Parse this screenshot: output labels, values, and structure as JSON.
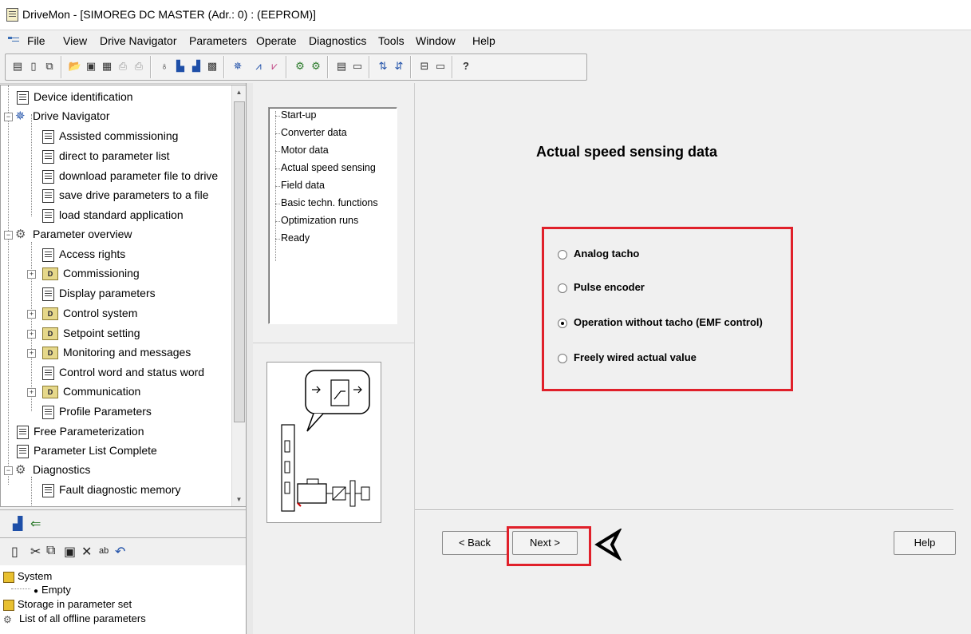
{
  "window": {
    "title": "DriveMon - [SIMOREG DC MASTER (Adr.: 0) : (EEPROM)]"
  },
  "menu": [
    "File",
    "View",
    "Drive Navigator",
    "Parameters",
    "Operate",
    "Diagnostics",
    "Tools",
    "Window",
    "Help"
  ],
  "tree": [
    {
      "label": "Device identification"
    },
    {
      "label": "Drive Navigator"
    },
    {
      "label": "Assisted commissioning"
    },
    {
      "label": "direct to parameter list"
    },
    {
      "label": "download parameter file to drive"
    },
    {
      "label": "save drive parameters to a file"
    },
    {
      "label": "load standard application"
    },
    {
      "label": "Parameter overview"
    },
    {
      "label": "Access rights"
    },
    {
      "label": "Commissioning"
    },
    {
      "label": "Display parameters"
    },
    {
      "label": "Control system"
    },
    {
      "label": "Setpoint setting"
    },
    {
      "label": "Monitoring and messages"
    },
    {
      "label": "Control word and status word"
    },
    {
      "label": "Communication"
    },
    {
      "label": "Profile Parameters"
    },
    {
      "label": "Free Parameterization"
    },
    {
      "label": "Parameter List Complete"
    },
    {
      "label": "Diagnostics"
    },
    {
      "label": "Fault diagnostic memory"
    }
  ],
  "lower_tree": {
    "system": "System",
    "empty": "Empty",
    "storage": "Storage in parameter set",
    "list": "List of all offline parameters"
  },
  "steps": [
    "Start-up",
    "Converter data",
    "Motor data",
    "Actual speed sensing",
    "Field data",
    "Basic techn. functions",
    "Optimization runs",
    "Ready"
  ],
  "main": {
    "heading": "Actual speed sensing data",
    "options": [
      {
        "label": "Analog tacho",
        "selected": false
      },
      {
        "label": "Pulse encoder",
        "selected": false
      },
      {
        "label": "Operation without tacho (EMF control)",
        "selected": true
      },
      {
        "label": "Freely wired actual value",
        "selected": false
      }
    ],
    "back_label": "< Back",
    "next_label": "Next >",
    "help_label": "Help"
  },
  "colors": {
    "highlight_red": "#e0202a"
  }
}
